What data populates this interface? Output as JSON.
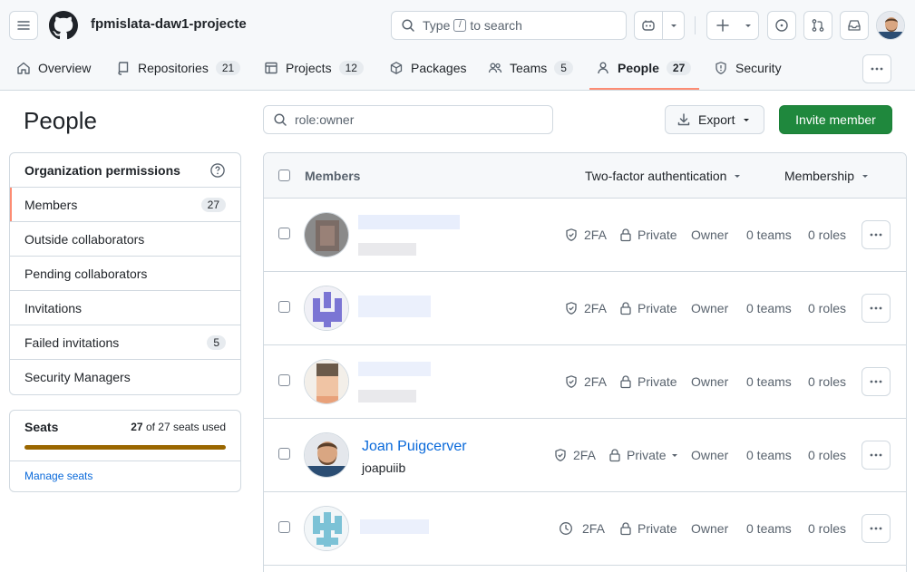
{
  "header": {
    "org_name": "fpmislata-daw1-projecte",
    "search_prefix": "Type",
    "search_key": "/",
    "search_suffix": "to search"
  },
  "tabs": [
    {
      "label": "Overview",
      "icon": "home-icon"
    },
    {
      "label": "Repositories",
      "count": "21",
      "icon": "repo-icon"
    },
    {
      "label": "Projects",
      "count": "12",
      "icon": "table-icon"
    },
    {
      "label": "Packages",
      "icon": "package-icon"
    },
    {
      "label": "Teams",
      "count": "5",
      "icon": "people-icon"
    },
    {
      "label": "People",
      "count": "27",
      "icon": "person-icon",
      "active": true
    },
    {
      "label": "Security",
      "icon": "shield-icon"
    }
  ],
  "page": {
    "title": "People",
    "filter_value": "role:owner",
    "export_label": "Export",
    "invite_label": "Invite member"
  },
  "sidebar": {
    "heading": "Organization permissions",
    "items": [
      {
        "label": "Members",
        "count": "27",
        "active": true
      },
      {
        "label": "Outside collaborators"
      },
      {
        "label": "Pending collaborators"
      },
      {
        "label": "Invitations"
      },
      {
        "label": "Failed invitations",
        "count": "5"
      },
      {
        "label": "Security Managers"
      }
    ]
  },
  "seats": {
    "title": "Seats",
    "used": "27",
    "used_suffix": "of 27 seats used",
    "fill_fraction": 1.0,
    "manage_label": "Manage seats"
  },
  "table": {
    "col_members": "Members",
    "col_2fa": "Two-factor authentication",
    "col_membership": "Membership",
    "rows": [
      {
        "name": "",
        "login": "",
        "twofa": "2FA",
        "twofa_icon": "shield-check-icon",
        "visibility": "Private",
        "role": "Owner",
        "teams": "0 teams",
        "roles": "0 roles"
      },
      {
        "name": "",
        "login": "",
        "twofa": "2FA",
        "twofa_icon": "shield-check-icon",
        "visibility": "Private",
        "role": "Owner",
        "teams": "0 teams",
        "roles": "0 roles"
      },
      {
        "name": "",
        "login": "",
        "twofa": "2FA",
        "twofa_icon": "shield-check-icon",
        "visibility": "Private",
        "role": "Owner",
        "teams": "0 teams",
        "roles": "0 roles"
      },
      {
        "name": "Joan Puigcerver",
        "login": "joapuiib",
        "twofa": "2FA",
        "twofa_icon": "shield-check-icon",
        "visibility": "Private",
        "role": "Owner",
        "teams": "0 teams",
        "roles": "0 roles"
      },
      {
        "name": "",
        "login": "",
        "twofa": "2FA",
        "twofa_icon": "clock-icon",
        "visibility": "Private",
        "role": "Owner",
        "teams": "0 teams",
        "roles": "0 roles"
      }
    ]
  },
  "colors": {
    "accent_tab": "#fd8c73",
    "primary_button": "#1f883d",
    "link": "#0969da",
    "seats_bar": "#9a6700"
  }
}
